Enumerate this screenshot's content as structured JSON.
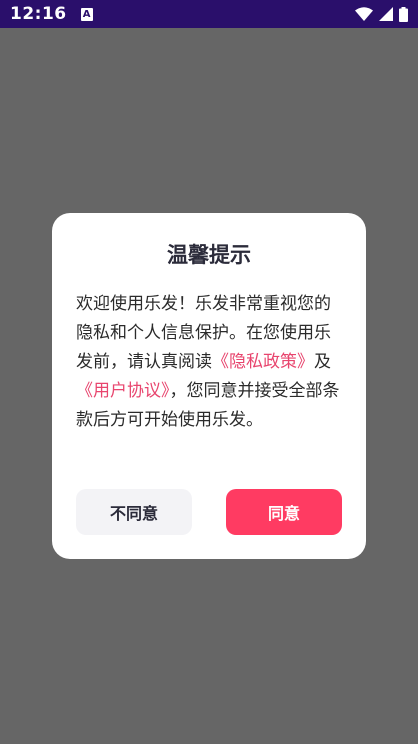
{
  "status_bar": {
    "time": "12:16",
    "notification_letter": "A",
    "icons": [
      "wifi-icon",
      "signal-icon",
      "battery-icon"
    ]
  },
  "dialog": {
    "title": "温馨提示",
    "body_before_privacy": "欢迎使用乐发！乐发非常重视您的隐私和个人信息保护。在您使用乐发前，请认真阅读",
    "privacy_link": "《隐私政策》",
    "body_middle": "及",
    "agreement_link": "《用户协议》",
    "body_after": "，您同意并接受全部条款后方可开始使用乐发。",
    "decline_label": "不同意",
    "agree_label": "同意"
  },
  "colors": {
    "status_bar": "#2a0f6b",
    "scrim": "#666666",
    "link": "#e8456e",
    "agree_button": "#ff3b62",
    "decline_button": "#f3f3f6"
  }
}
